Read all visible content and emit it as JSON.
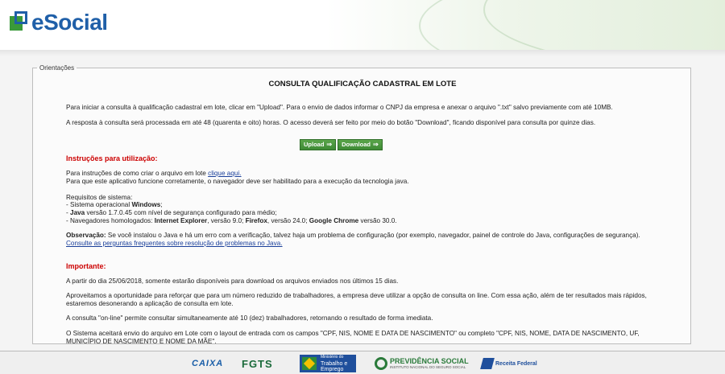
{
  "header": {
    "logo_text": "eSocial"
  },
  "panel": {
    "legend": "Orientações",
    "title": "CONSULTA QUALIFICAÇÃO CADASTRAL EM LOTE",
    "intro_1": "Para iniciar a consulta à qualificação cadastral em lote, clicar em \"Upload\". Para o envio de dados informar o CNPJ da empresa e anexar o arquivo \".txt\" salvo previamente com até 10MB.",
    "intro_2": "A resposta à consulta será processada em até 48 (quarenta e oito) horas. O acesso deverá ser feito por meio do botão \"Download\", ficando disponível para consulta por quinze dias.",
    "upload_label": "Upload",
    "download_label": "Download",
    "instr_heading": "Instruções para utilização:",
    "instr_1_prefix": "Para instruções de como criar o arquivo em lote ",
    "instr_1_link": "clique aqui.",
    "instr_2": "Para que este aplicativo funcione corretamente, o navegador deve ser habilitado para a execução da tecnologia java.",
    "req_heading": "Requisitos de sistema:",
    "req_1_prefix": "- Sistema operacional ",
    "req_1_bold": "Windows",
    "req_1_suffix": ";",
    "req_2_prefix": "- ",
    "req_2_bold": "Java",
    "req_2_suffix": " versão 1.7.0.45 com nível de segurança configurado para médio;",
    "req_3_prefix": "- Navegadores homologados: ",
    "req_3_ie": "Internet Explorer",
    "req_3_mid1": ", versão 9.0; ",
    "req_3_ff": "Firefox",
    "req_3_mid2": ", versão 24.0; ",
    "req_3_gc": "Google Chrome",
    "req_3_suffix": " versão 30.0.",
    "obs_bold": "Observação:",
    "obs_text": " Se você instalou o Java e há um erro com a verificação, talvez haja um problema de configuração (por exemplo, navegador, painel de controle do Java, configurações de segurança).",
    "obs_link": "Consulte as perguntas frequentes sobre resolução de problemas no Java.",
    "imp_heading": "Importante:",
    "imp_1": "A partir do dia 25/06/2018, somente estarão disponíveis para download os arquivos enviados nos últimos 15 dias.",
    "imp_2": "Aproveitamos a oportunidade para reforçar que para um número reduzido de trabalhadores, a empresa deve utilizar a opção de consulta on line. Com essa ação, além de ter resultados mais rápidos, estaremos desonerando a aplicação de consulta em lote.",
    "imp_3": "A consulta \"on-line\" permite consultar simultaneamente até 10 (dez) trabalhadores, retornando o resultado de forma imediata.",
    "imp_4": "O Sistema aceitará envio do arquivo em Lote com o layout de entrada com os campos \"CPF, NIS, NOME E DATA DE NASCIMENTO\" ou completo \"CPF, NIS, NOME, DATA DE NASCIMENTO, UF, MUNICÍPIO DE NASCIMENTO E NOME DA MÃE\"."
  },
  "footer": {
    "caixa": "CAIXA",
    "fgts": "FGTS",
    "trabalho_line1": "Ministério do",
    "trabalho_line2": "Trabalho e",
    "trabalho_line3": "Emprego",
    "previdencia": "PREVIDÊNCIA SOCIAL",
    "previdencia_sub": "INSTITUTO NACIONAL DO SEGURO SOCIAL",
    "receita": "Receita Federal"
  },
  "colors": {
    "accent_red": "#cc0000",
    "button_green": "#4a9a40",
    "link_blue": "#1a3f9a",
    "brand_blue": "#1f5fa8"
  }
}
